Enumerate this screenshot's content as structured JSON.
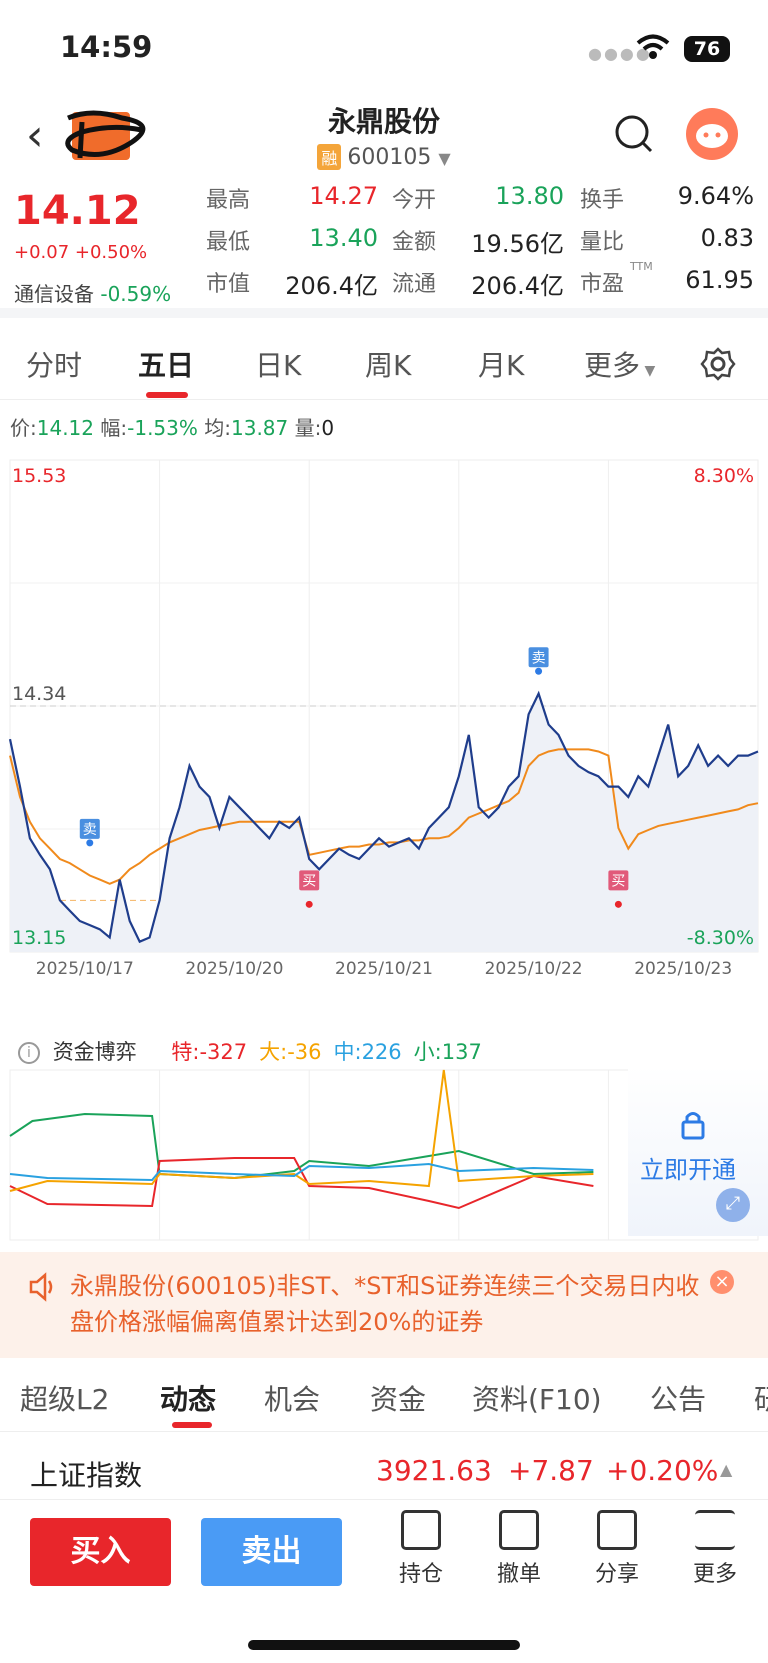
{
  "status": {
    "time": "14:59",
    "battery": "76"
  },
  "nav": {
    "title": "永鼎股份",
    "badge": "融",
    "code": "600105"
  },
  "quote": {
    "price": "14.12",
    "change": "+0.07 +0.50%",
    "sector_name": "通信设备",
    "sector_change": "-0.59%",
    "fields": [
      {
        "label": "最高",
        "value": "14.27",
        "color": "red"
      },
      {
        "label": "今开",
        "value": "13.80",
        "color": "green"
      },
      {
        "label": "换手",
        "value": "9.64%",
        "color": "black"
      },
      {
        "label": "最低",
        "value": "13.40",
        "color": "green"
      },
      {
        "label": "金额",
        "value": "19.56亿",
        "color": "black"
      },
      {
        "label": "量比",
        "value": "0.83",
        "color": "black"
      },
      {
        "label": "市值",
        "value": "206.4亿",
        "color": "black"
      },
      {
        "label": "流通",
        "value": "206.4亿",
        "color": "black"
      },
      {
        "label": "市盈",
        "value": "61.95",
        "color": "black",
        "sup": "TTM"
      }
    ]
  },
  "tabs": [
    "分时",
    "五日",
    "日K",
    "周K",
    "月K",
    "更多"
  ],
  "active_tab": "五日",
  "infoline": {
    "price_label": "价:",
    "price": "14.12",
    "range_label": "幅:",
    "range": "-1.53%",
    "avg_label": "均:",
    "avg": "13.87",
    "vol_label": "量:",
    "vol": "0"
  },
  "chart_data": {
    "type": "line",
    "y_left_ticks": [
      "15.53",
      "14.34",
      "13.15"
    ],
    "y_right_ticks": [
      "8.30%",
      "-8.30%"
    ],
    "ylim": [
      13.15,
      15.53
    ],
    "x_labels": [
      "2025/10/17",
      "2025/10/20",
      "2025/10/21",
      "2025/10/22",
      "2025/10/23"
    ],
    "series": [
      {
        "color": "#1f3d8c",
        "values": [
          14.18,
          13.95,
          13.7,
          13.62,
          13.55,
          13.4,
          13.35,
          13.3,
          13.28,
          13.26,
          13.22,
          13.5,
          13.3,
          13.2,
          13.22,
          13.4,
          13.7,
          13.85,
          14.05,
          13.95,
          13.9,
          13.75,
          13.9,
          13.85,
          13.8,
          13.75,
          13.7,
          13.78,
          13.75,
          13.8,
          13.6,
          13.55,
          13.6,
          13.65,
          13.62,
          13.6,
          13.65,
          13.7,
          13.66,
          13.68,
          13.7,
          13.65,
          13.75,
          13.8,
          13.85,
          14.0,
          14.2,
          13.85,
          13.8,
          13.85,
          13.95,
          14.0,
          14.3,
          14.4,
          14.25,
          14.2,
          14.1,
          14.05,
          14.02,
          14.0,
          13.95,
          13.95,
          13.9,
          14.0,
          13.95,
          14.1,
          14.25,
          14.0,
          14.05,
          14.15,
          14.05,
          14.1,
          14.05,
          14.1,
          14.1,
          14.12
        ]
      },
      {
        "color": "#f08a1c",
        "values": [
          14.1,
          13.9,
          13.78,
          13.7,
          13.65,
          13.6,
          13.58,
          13.55,
          13.52,
          13.5,
          13.48,
          13.5,
          13.55,
          13.58,
          13.62,
          13.65,
          13.68,
          13.7,
          13.72,
          13.74,
          13.75,
          13.76,
          13.77,
          13.78,
          13.78,
          13.78,
          13.78,
          13.78,
          13.78,
          13.78,
          13.62,
          13.63,
          13.64,
          13.65,
          13.66,
          13.66,
          13.67,
          13.67,
          13.68,
          13.68,
          13.69,
          13.69,
          13.7,
          13.7,
          13.71,
          13.75,
          13.8,
          13.82,
          13.84,
          13.86,
          13.88,
          13.92,
          14.05,
          14.1,
          14.12,
          14.13,
          14.13,
          14.13,
          14.13,
          14.12,
          14.1,
          13.75,
          13.65,
          13.72,
          13.74,
          13.76,
          13.77,
          13.78,
          13.79,
          13.8,
          13.81,
          13.82,
          13.83,
          13.84,
          13.86,
          13.87
        ]
      }
    ],
    "markers": [
      {
        "text": "卖",
        "type": "sell"
      },
      {
        "text": "买",
        "type": "buy"
      },
      {
        "text": "卖",
        "type": "sell"
      },
      {
        "text": "买",
        "type": "buy"
      }
    ]
  },
  "fund": {
    "title": "资金博弈",
    "items": [
      {
        "label": "特:",
        "value": "-327",
        "color": "#e8262b"
      },
      {
        "label": "大:",
        "value": "-36",
        "color": "#f5a300"
      },
      {
        "label": "中:",
        "value": "226",
        "color": "#2aa1e0"
      },
      {
        "label": "小:",
        "value": "137",
        "color": "#1aa35a"
      }
    ],
    "unlock_text": "立即开通"
  },
  "notice": {
    "text": "永鼎股份(600105)非ST、*ST和S证券连续三个交易日内收盘价格涨幅偏离值累计达到20%的证券"
  },
  "bottom_tabs": [
    "超级L2",
    "动态",
    "机会",
    "资金",
    "资料(F10)",
    "公告",
    "研"
  ],
  "active_bottom_tab": "动态",
  "index": {
    "name": "上证指数",
    "value": "3921.63",
    "change": "+7.87",
    "pct": "+0.20%"
  },
  "footer": {
    "buy": "买入",
    "sell": "卖出",
    "buttons": [
      "持仓",
      "撤单",
      "分享",
      "更多"
    ]
  }
}
